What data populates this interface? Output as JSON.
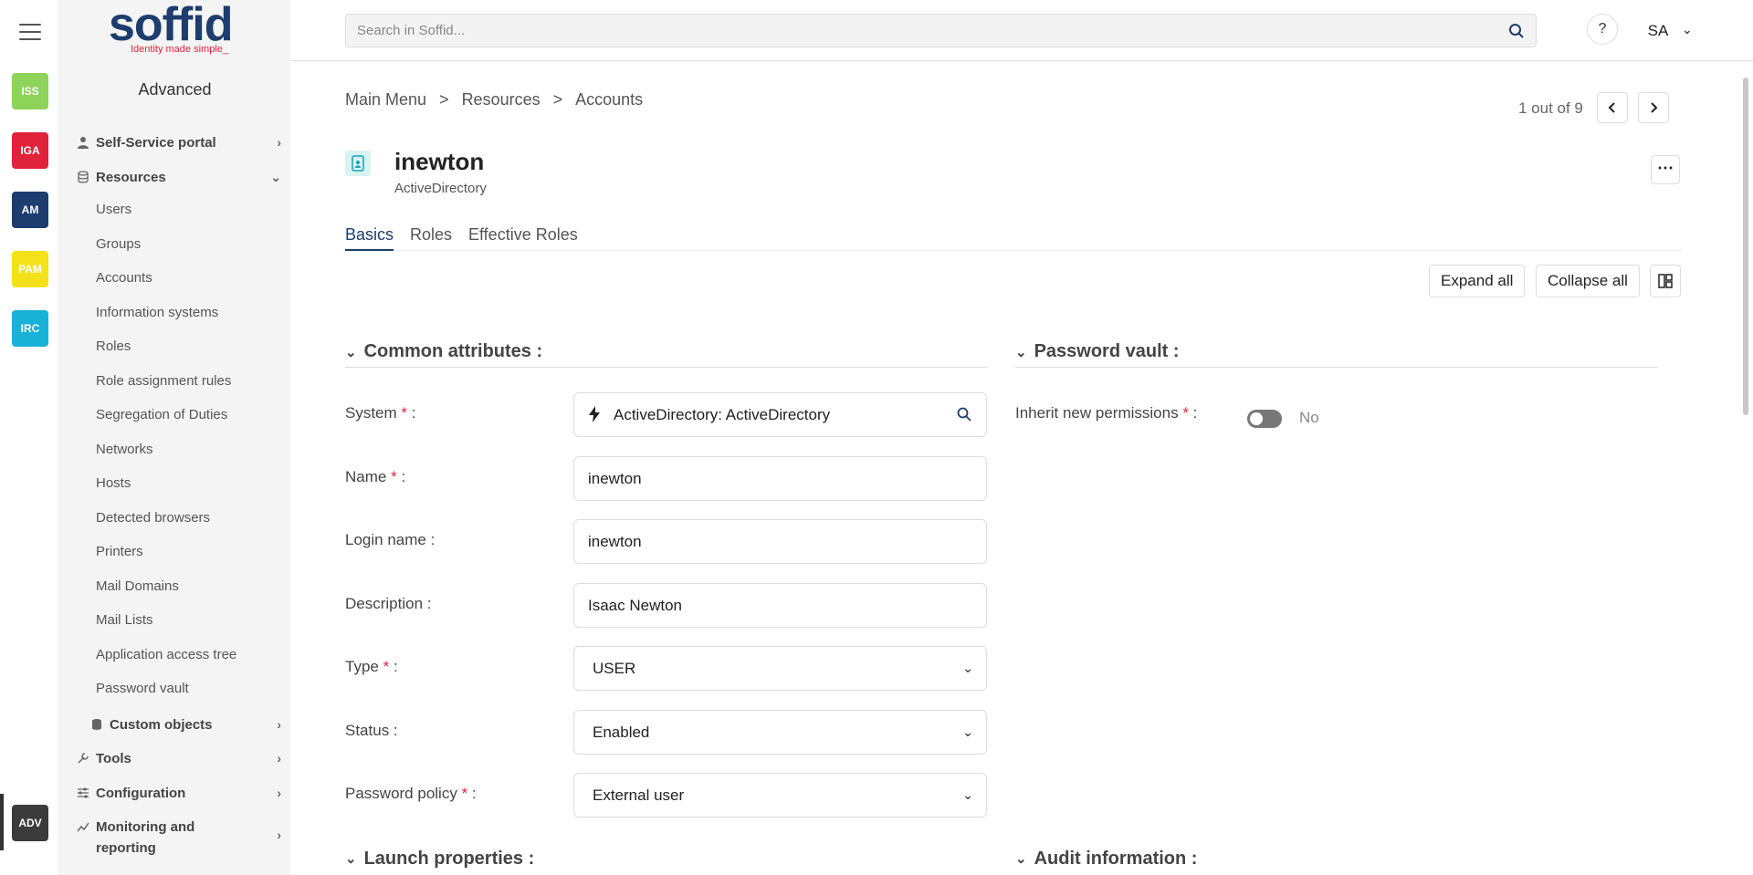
{
  "rail": {
    "apps": [
      {
        "label": "ISS",
        "color": "#8ed35a"
      },
      {
        "label": "IGA",
        "color": "#e0233b"
      },
      {
        "label": "AM",
        "color": "#1c3d6e"
      },
      {
        "label": "PAM",
        "color": "#f5e11a"
      },
      {
        "label": "IRC",
        "color": "#17b2d6"
      }
    ],
    "active_app": {
      "label": "ADV",
      "color": "#3b3b3b"
    }
  },
  "sidebar": {
    "logo_word": "soffid",
    "logo_tagline": "Identity made simple_",
    "title": "Advanced",
    "groups": {
      "self_service": "Self-Service portal",
      "resources": "Resources",
      "custom_objects": "Custom objects",
      "tools": "Tools",
      "configuration": "Configuration",
      "monitoring": "Monitoring and reporting"
    },
    "resource_items": [
      "Users",
      "Groups",
      "Accounts",
      "Information systems",
      "Roles",
      "Role assignment rules",
      "Segregation of Duties",
      "Networks",
      "Hosts",
      "Detected browsers",
      "Printers",
      "Mail Domains",
      "Mail Lists",
      "Application access tree",
      "Password vault"
    ]
  },
  "topbar": {
    "search_placeholder": "Search in Soffid...",
    "help": "?",
    "user_initials": "SA"
  },
  "breadcrumb": [
    "Main Menu",
    ">",
    "Resources",
    ">",
    "Accounts"
  ],
  "pager": {
    "text": "1 out of 9"
  },
  "account": {
    "name": "inewton",
    "system_label": "ActiveDirectory"
  },
  "tabs": [
    "Basics",
    "Roles",
    "Effective Roles"
  ],
  "toolbar": {
    "expand_all": "Expand all",
    "collapse_all": "Collapse all"
  },
  "sections": {
    "common": "Common attributes :",
    "vault": "Password vault :",
    "launch": "Launch properties :",
    "audit": "Audit information :"
  },
  "fields": {
    "system": {
      "label": "System",
      "value": "ActiveDirectory: ActiveDirectory"
    },
    "name": {
      "label": "Name",
      "value": "inewton"
    },
    "login": {
      "label": "Login name :",
      "value": "inewton"
    },
    "description": {
      "label": "Description :",
      "value": "Isaac Newton"
    },
    "type": {
      "label": "Type",
      "value": "USER"
    },
    "status": {
      "label": "Status :",
      "value": "Enabled"
    },
    "password_policy": {
      "label": "Password policy",
      "value": "External user"
    },
    "inherit": {
      "label": "Inherit new permissions",
      "value": "No"
    }
  },
  "required_marker": "*",
  "colon": " :"
}
